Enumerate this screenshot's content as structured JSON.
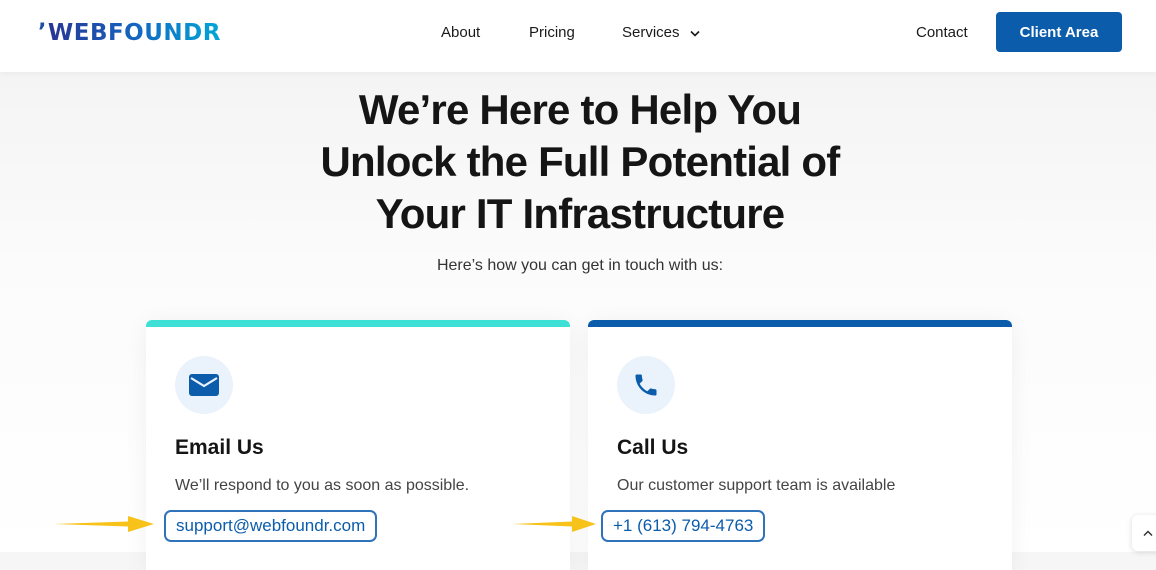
{
  "brand": {
    "logo_text": "WEBFOUNDR"
  },
  "nav": {
    "about": "About",
    "pricing": "Pricing",
    "services": "Services",
    "contact": "Contact",
    "client_area": "Client Area"
  },
  "hero": {
    "headline_lines": [
      "We’re Here to Help You",
      "Unlock the Full Potential of",
      "Your IT Infrastructure"
    ],
    "subtitle": "Here’s how you can get in touch with us:"
  },
  "cards": [
    {
      "icon": "envelope-icon",
      "title": "Email Us",
      "description": "We’ll respond to you as soon as possible.",
      "link": "support@webfoundr.com",
      "accent_color": "#3ee0d6"
    },
    {
      "icon": "phone-icon",
      "title": "Call Us",
      "description": "Our customer support team is available",
      "link": "+1 (613) 794-4763",
      "accent_color": "#0b5cab"
    }
  ],
  "colors": {
    "primary": "#0b5cab",
    "highlight_border": "#2f73ba",
    "arrow": "#f7c21a"
  }
}
